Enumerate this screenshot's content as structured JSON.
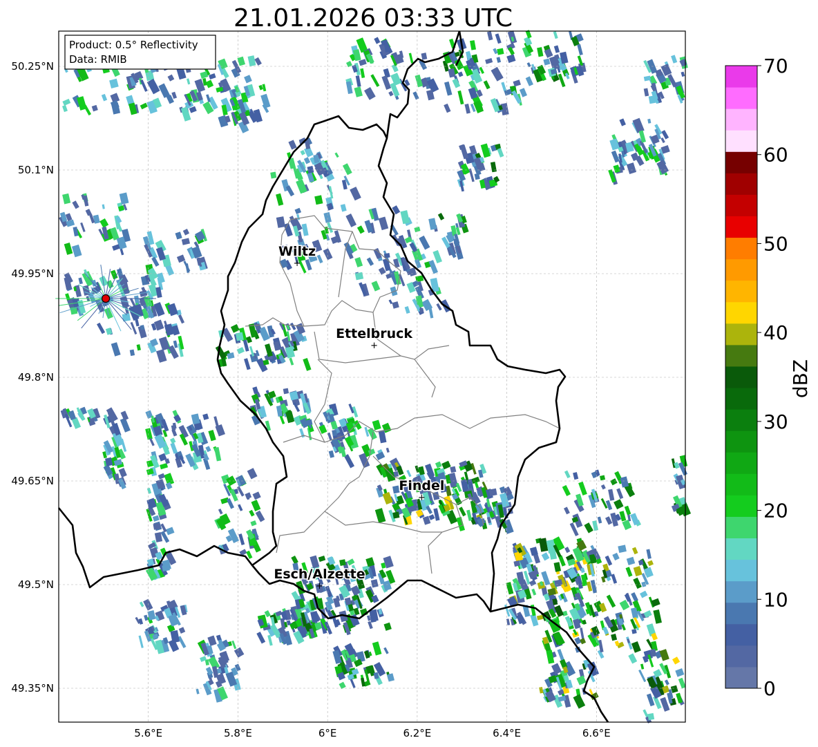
{
  "title": "21.01.2026 03:33 UTC",
  "info_box": {
    "line1": "Product: 0.5° Reflectivity",
    "line2": "Data: RMIB"
  },
  "map": {
    "lon_range": [
      5.4,
      6.8
    ],
    "lat_range": [
      49.3,
      50.3
    ],
    "lon_ticks": [
      "5.6°E",
      "5.8°E",
      "6°E",
      "6.2°E",
      "6.4°E",
      "6.6°E"
    ],
    "lat_ticks": [
      "50.25°N",
      "50.1°N",
      "49.95°N",
      "49.8°N",
      "49.65°N",
      "49.5°N",
      "49.35°N"
    ],
    "gridlines": true,
    "radar_site": {
      "lon": 5.505,
      "lat": 49.914
    }
  },
  "cities": [
    {
      "name": "Wiltz",
      "lon": 5.932,
      "lat": 49.966
    },
    {
      "name": "Ettelbruck",
      "lon": 6.104,
      "lat": 49.847
    },
    {
      "name": "Findel",
      "lon": 6.21,
      "lat": 49.627
    },
    {
      "name": "Esch/Alzette",
      "lon": 5.982,
      "lat": 49.499
    }
  ],
  "colorbar": {
    "label": "dBZ",
    "ticks": [
      "0",
      "10",
      "20",
      "30",
      "40",
      "50",
      "60",
      "70"
    ],
    "colors": [
      "#6577a8",
      "#5368a3",
      "#4460a3",
      "#4a78b0",
      "#5b9cc9",
      "#67c2dc",
      "#62d7c2",
      "#3ed66e",
      "#14cc1e",
      "#12bb18",
      "#10a814",
      "#0e9410",
      "#0b7f0e",
      "#096a0b",
      "#0a5a0a",
      "#467a10",
      "#acb40c",
      "#ffd600",
      "#ffb500",
      "#ff9a00",
      "#ff7d00",
      "#e80000",
      "#c40000",
      "#a00000",
      "#760000",
      "#ffe0ff",
      "#ffb4ff",
      "#ff6cff",
      "#ea3aea"
    ]
  }
}
